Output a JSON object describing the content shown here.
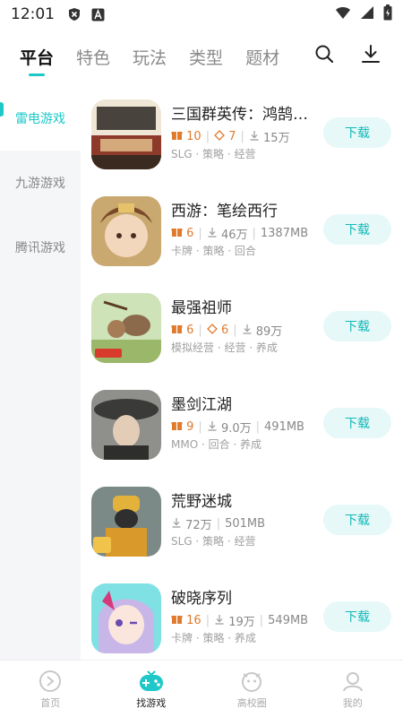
{
  "status_bar": {
    "time": "12:01",
    "icons": [
      "close-shield-icon",
      "a-badge-icon",
      "wifi-icon",
      "signal-icon",
      "battery-icon"
    ]
  },
  "top_tabs": [
    {
      "label": "平台",
      "active": true
    },
    {
      "label": "特色",
      "active": false
    },
    {
      "label": "玩法",
      "active": false
    },
    {
      "label": "类型",
      "active": false
    },
    {
      "label": "题材",
      "active": false
    }
  ],
  "top_actions": [
    "search-icon",
    "download-icon"
  ],
  "sidebar": {
    "items": [
      {
        "label": "雷电游戏",
        "active": true
      },
      {
        "label": "九游游戏",
        "active": false
      },
      {
        "label": "腾讯游戏",
        "active": false
      }
    ]
  },
  "games": [
    {
      "name": "三国群英传：鸿鹄霸业",
      "gifts": "10",
      "diamonds": "7",
      "downloads": "15万",
      "size": "",
      "tags": "SLG · 策略 · 经营",
      "button": "下载"
    },
    {
      "name": "西游：笔绘西行",
      "gifts": "6",
      "diamonds": "",
      "downloads": "46万",
      "size": "1387MB",
      "tags": "卡牌 · 策略 · 回合",
      "button": "下载"
    },
    {
      "name": "最强祖师",
      "gifts": "6",
      "diamonds": "6",
      "downloads": "89万",
      "size": "",
      "tags": "模拟经营 · 经营 · 养成",
      "button": "下载"
    },
    {
      "name": "墨剑江湖",
      "gifts": "9",
      "diamonds": "",
      "downloads": "9.0万",
      "size": "491MB",
      "tags": "MMO · 回合 · 养成",
      "button": "下载"
    },
    {
      "name": "荒野迷城",
      "gifts": "",
      "diamonds": "",
      "downloads": "72万",
      "size": "501MB",
      "tags": "SLG · 策略 · 经营",
      "button": "下载"
    },
    {
      "name": "破晓序列",
      "gifts": "16",
      "diamonds": "",
      "downloads": "19万",
      "size": "549MB",
      "tags": "卡牌 · 策略 · 养成",
      "button": "下载"
    }
  ],
  "bottom_nav": [
    {
      "label": "首页",
      "active": false
    },
    {
      "label": "找游戏",
      "active": true
    },
    {
      "label": "高校圈",
      "active": false
    },
    {
      "label": "我的",
      "active": false
    }
  ],
  "colors": {
    "accent": "#1ec8c8",
    "gift": "#e07a2d",
    "button_bg": "#e6f8f8"
  }
}
